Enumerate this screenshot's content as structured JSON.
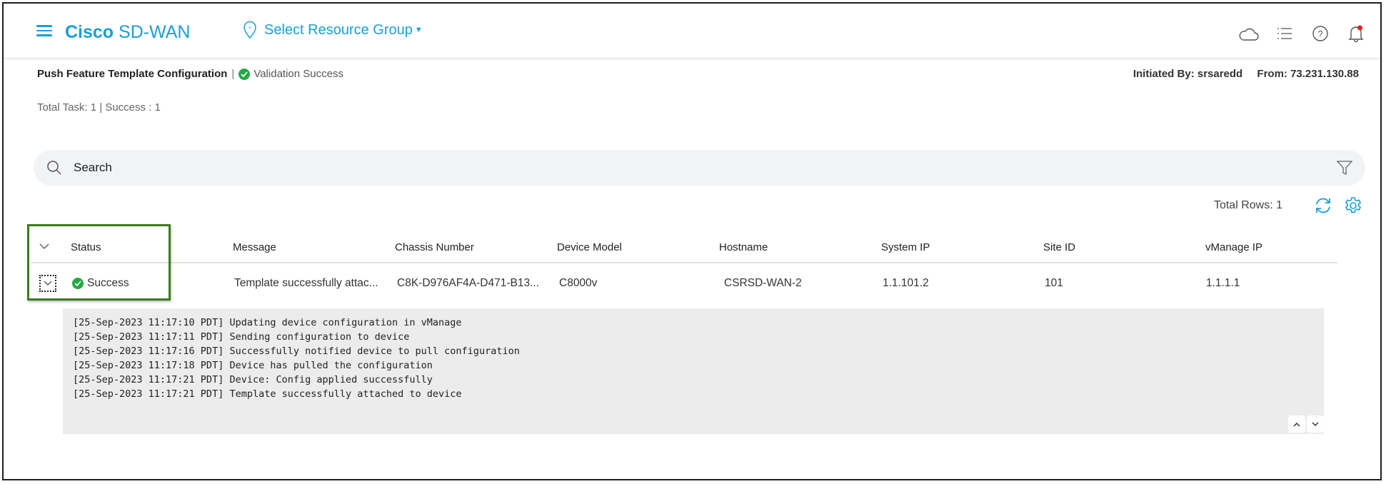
{
  "header": {
    "brand_bold": "Cisco",
    "brand_rest": " SD-WAN",
    "resource_group_label": "Select Resource Group",
    "icons": [
      "cloud-icon",
      "task-list-icon",
      "help-icon",
      "notification-bell-icon"
    ],
    "notification_dot_color": "#e0251b",
    "accent_color": "#1a9fd6"
  },
  "task": {
    "title": "Push Feature Template Configuration",
    "separator": "|",
    "validation_status": "Validation Success",
    "initiated_by": "Initiated By: srsaredd",
    "from": "From: 73.231.130.88",
    "totals": "Total Task: 1 | Success : 1"
  },
  "search": {
    "placeholder": "Search"
  },
  "table": {
    "total_rows": "Total Rows: 1",
    "columns": [
      "Status",
      "Message",
      "Chassis Number",
      "Device Model",
      "Hostname",
      "System IP",
      "Site ID",
      "vManage IP"
    ],
    "rows": [
      {
        "status": "Success",
        "message": "Template successfully attac...",
        "chassis_number": "C8K-D976AF4A-D471-B13...",
        "device_model": "C8000v",
        "hostname": "CSRSD-WAN-2",
        "system_ip": "1.1.101.2",
        "site_id": "101",
        "vmanage_ip": "1.1.1.1"
      }
    ]
  },
  "log": {
    "lines": [
      "[25-Sep-2023 11:17:10 PDT] Updating device configuration in vManage",
      "[25-Sep-2023 11:17:11 PDT] Sending configuration to device",
      "[25-Sep-2023 11:17:16 PDT] Successfully notified device to pull configuration",
      "[25-Sep-2023 11:17:18 PDT] Device has pulled the configuration",
      "[25-Sep-2023 11:17:21 PDT] Device: Config applied successfully",
      "[25-Sep-2023 11:17:21 PDT] Template successfully attached to device"
    ]
  },
  "colors": {
    "success_green": "#28a745",
    "highlight_border": "#3f7a1f"
  }
}
